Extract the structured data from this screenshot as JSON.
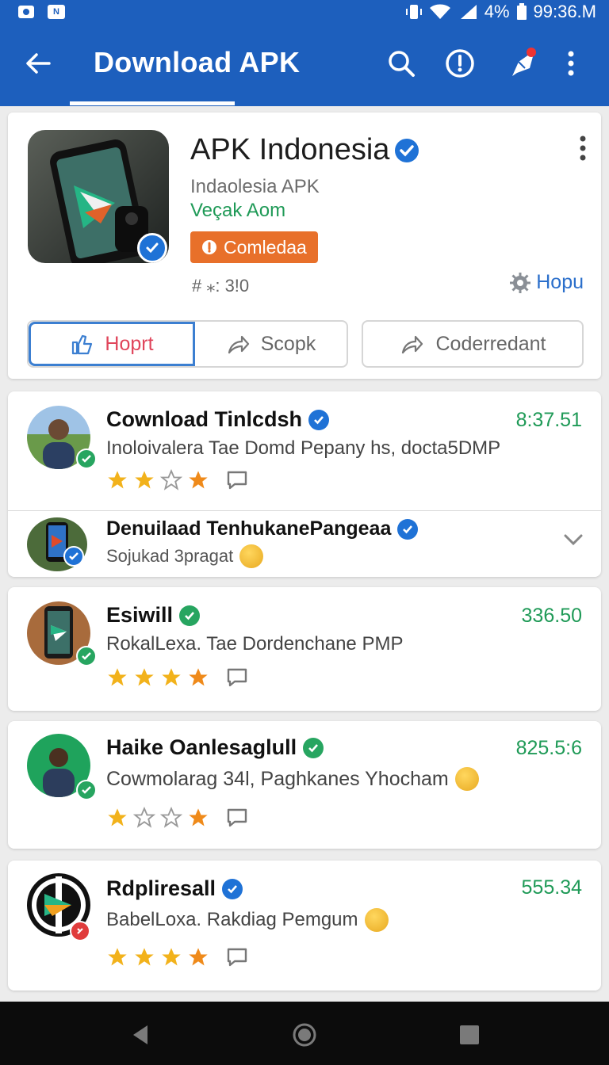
{
  "status_bar": {
    "network_label": "4¹⁄₀",
    "battery_label": "4%",
    "time": "99:36.M",
    "carrier_box": "N"
  },
  "app_bar": {
    "title": "Download APK",
    "icons": [
      "back-arrow-icon",
      "search-icon",
      "info-icon",
      "rocket-icon",
      "more-vert-icon"
    ]
  },
  "app": {
    "name": "APK Indonesia",
    "subtitle": "Indaolesia APK",
    "developer": "Veçak Aom",
    "tag": "Comledaa",
    "count": "# ⁎: 3!0",
    "help": "Hopu",
    "seg_left": "Hoprt",
    "seg_mid": "Scopk",
    "seg_right": "Coderredant"
  },
  "items": [
    {
      "name": "Cownload Tinlcdsh",
      "desc": "Inoloivalera Tae Domd Pepany hs, docta5DMP",
      "value": "8:37.51",
      "rating": 2,
      "verified": "blue"
    },
    {
      "name": "Denuilaad TenhukanePangeaa",
      "desc": "Sojukad 3pragat",
      "verified": "blue"
    },
    {
      "name": "Esiwill",
      "desc": "RokalLexa. Tae Dordenchane PMP",
      "value": "336.50",
      "rating": 4,
      "verified": "green"
    },
    {
      "name": "Haike Oanlesaglull",
      "desc": "Cowmolarag 34l, Paghkanes Yhocham",
      "value": "825.5:6",
      "rating": 1,
      "verified": "green"
    },
    {
      "name": "Rdpliresall",
      "desc": "BabelLoxa. Rakdiag Pemgum",
      "value": "555.34",
      "rating": 3,
      "verified": "blue"
    }
  ],
  "colors": {
    "primary": "#1d5fbd",
    "accent_green": "#1f9a57",
    "tag_orange": "#e8702a",
    "star_gold": "#f2b21b",
    "star_orange": "#ef8a1a"
  }
}
